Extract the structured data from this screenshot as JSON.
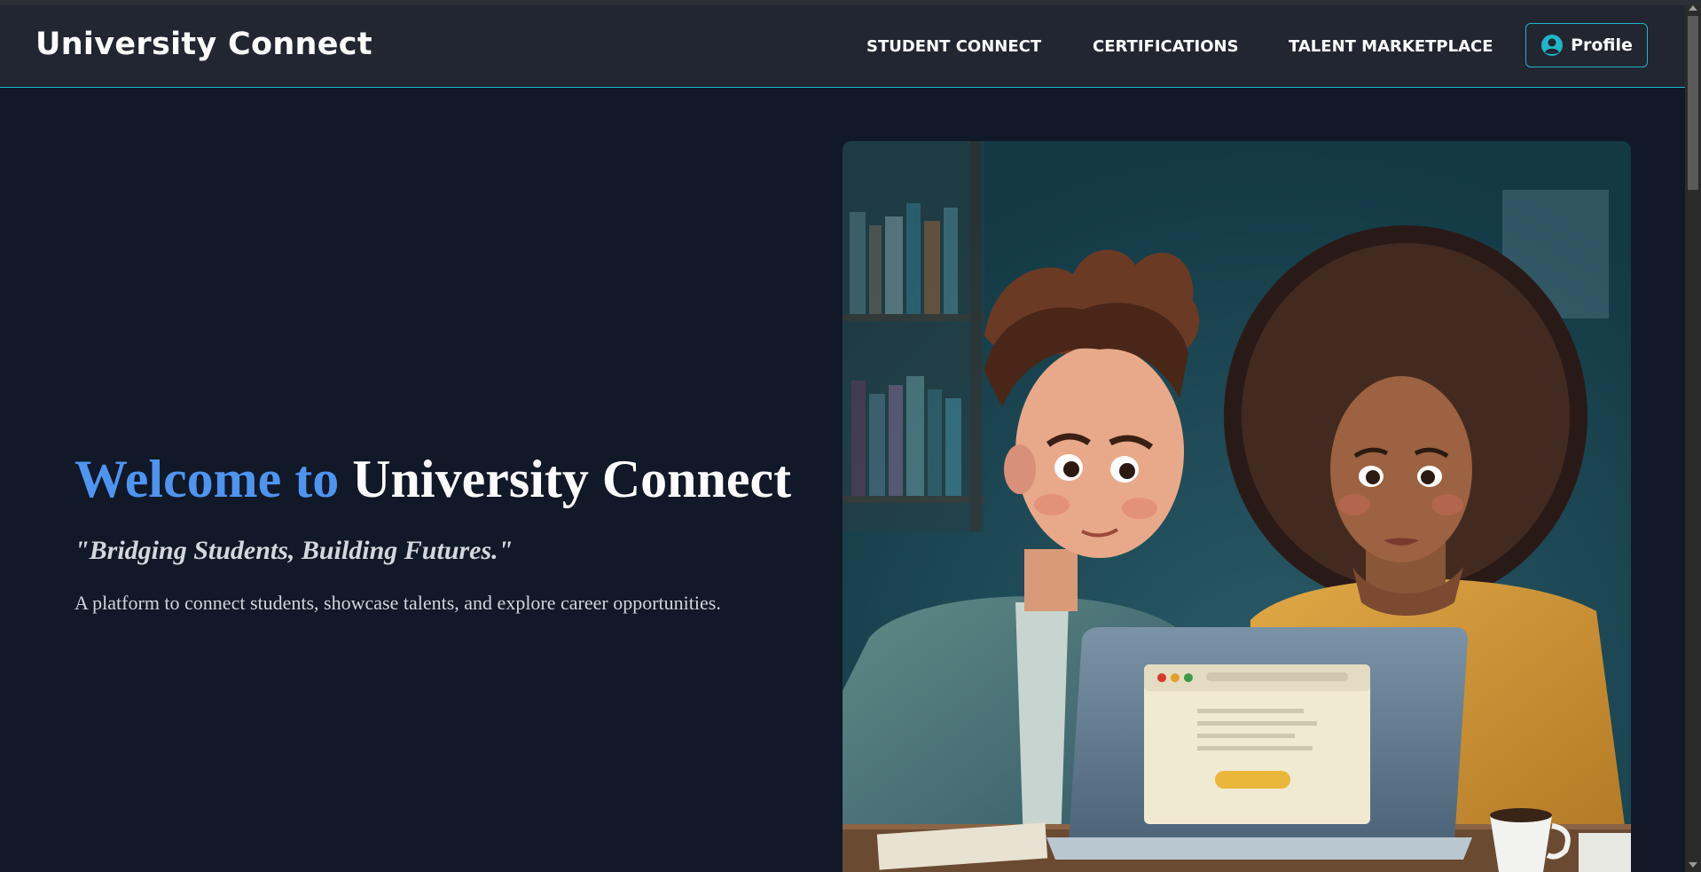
{
  "navbar": {
    "brand": "University Connect",
    "links": [
      "STUDENT CONNECT",
      "CERTIFICATIONS",
      "TALENT MARKETPLACE"
    ],
    "profile_label": "Profile",
    "profile_icon": "user-circle-icon"
  },
  "hero": {
    "title_accent": "Welcome to",
    "title_main": "University Connect",
    "tagline": "\"Bridging Students, Building Futures.\"",
    "description": "A platform to connect students, showcase talents, and explore career opportunities.",
    "image_subject": "two students at a laptop illustration"
  },
  "colors": {
    "background": "#111827",
    "navbar": "#222631",
    "accent_cyan": "#1fb6c9",
    "accent_blue": "#4e94f0"
  }
}
